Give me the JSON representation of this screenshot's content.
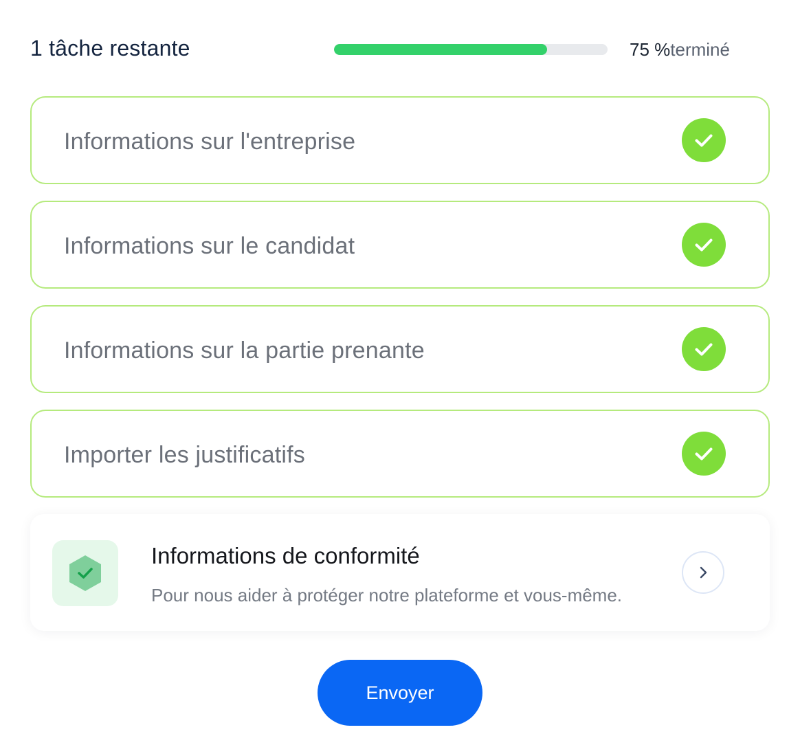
{
  "header": {
    "remaining_text": "1 tâche restante",
    "progress_percent": 75,
    "progress_value_text": "75 %",
    "progress_suffix": "terminé",
    "progress_color": "#33d16a"
  },
  "tasks": [
    {
      "label": "Informations sur l'entreprise",
      "status": "completed",
      "icon": "check-icon"
    },
    {
      "label": "Informations sur le candidat",
      "status": "completed",
      "icon": "check-icon"
    },
    {
      "label": "Informations sur la partie prenante",
      "status": "completed",
      "icon": "check-icon"
    },
    {
      "label": "Importer les justificatifs",
      "status": "completed",
      "icon": "check-icon"
    }
  ],
  "compliance": {
    "title": "Informations de conformité",
    "subtitle": "Pour nous aider à protéger notre plateforme et vous-même.",
    "icon": "shield-check-icon",
    "action_icon": "chevron-right-icon"
  },
  "actions": {
    "submit_label": "Envoyer",
    "submit_color": "#0a67f4"
  },
  "colors": {
    "task_border": "#b5ea7d",
    "check_fill": "#7fdd3a"
  }
}
